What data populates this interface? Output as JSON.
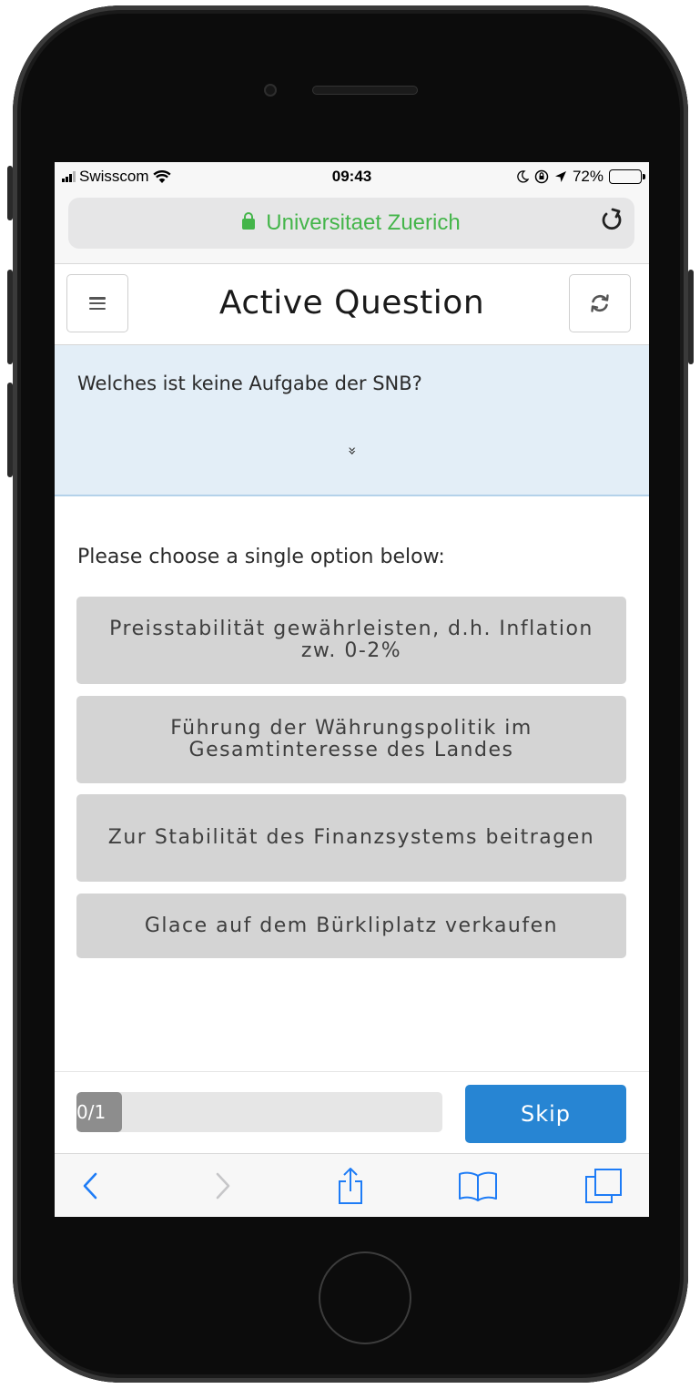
{
  "status_bar": {
    "carrier": "Swisscom",
    "time": "09:43",
    "battery": "72%",
    "battery_level": 0.72
  },
  "browser": {
    "url_label": "Universitaet Zuerich",
    "reload_icon": "reload-icon"
  },
  "header": {
    "title": "Active Question",
    "menu_icon": "hamburger-icon",
    "refresh_icon": "refresh-icon"
  },
  "question": {
    "text": "Welches ist keine Aufgabe der SNB?",
    "expand_glyph": "»"
  },
  "options_prompt": "Please choose a single option below:",
  "options": [
    {
      "label": "Preisstabilität gewährleisten, d.h. Inflation zw. 0-2%"
    },
    {
      "label": "Führung der Währungspolitik im Gesamtinteresse des Landes"
    },
    {
      "label": "Zur Stabilität des Finanzsystems beitragen"
    },
    {
      "label": "Glace auf dem Bürkliplatz verkaufen"
    }
  ],
  "footer": {
    "progress_label": "0/1",
    "progress_fraction": 0.125,
    "skip_label": "Skip"
  },
  "colors": {
    "accent": "#2785d3",
    "secure_green": "#44b54a",
    "question_bg": "#e3eef7",
    "option_bg": "#d4d4d4",
    "ios_blue": "#1e7cf6"
  },
  "toolbar_icons": [
    "back-icon",
    "forward-icon",
    "share-icon",
    "bookmarks-icon",
    "tabs-icon"
  ]
}
